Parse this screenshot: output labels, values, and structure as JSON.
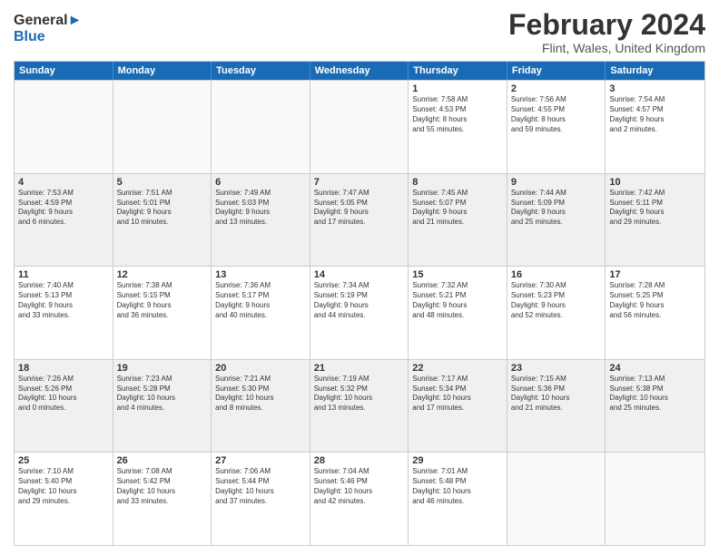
{
  "logo": {
    "line1": "General",
    "line2": "Blue"
  },
  "title": "February 2024",
  "subtitle": "Flint, Wales, United Kingdom",
  "days": [
    "Sunday",
    "Monday",
    "Tuesday",
    "Wednesday",
    "Thursday",
    "Friday",
    "Saturday"
  ],
  "rows": [
    [
      {
        "day": "",
        "empty": true
      },
      {
        "day": "",
        "empty": true
      },
      {
        "day": "",
        "empty": true
      },
      {
        "day": "",
        "empty": true
      },
      {
        "day": "1",
        "line1": "Sunrise: 7:58 AM",
        "line2": "Sunset: 4:53 PM",
        "line3": "Daylight: 8 hours",
        "line4": "and 55 minutes."
      },
      {
        "day": "2",
        "line1": "Sunrise: 7:56 AM",
        "line2": "Sunset: 4:55 PM",
        "line3": "Daylight: 8 hours",
        "line4": "and 59 minutes."
      },
      {
        "day": "3",
        "line1": "Sunrise: 7:54 AM",
        "line2": "Sunset: 4:57 PM",
        "line3": "Daylight: 9 hours",
        "line4": "and 2 minutes."
      }
    ],
    [
      {
        "day": "4",
        "line1": "Sunrise: 7:53 AM",
        "line2": "Sunset: 4:59 PM",
        "line3": "Daylight: 9 hours",
        "line4": "and 6 minutes."
      },
      {
        "day": "5",
        "line1": "Sunrise: 7:51 AM",
        "line2": "Sunset: 5:01 PM",
        "line3": "Daylight: 9 hours",
        "line4": "and 10 minutes."
      },
      {
        "day": "6",
        "line1": "Sunrise: 7:49 AM",
        "line2": "Sunset: 5:03 PM",
        "line3": "Daylight: 9 hours",
        "line4": "and 13 minutes."
      },
      {
        "day": "7",
        "line1": "Sunrise: 7:47 AM",
        "line2": "Sunset: 5:05 PM",
        "line3": "Daylight: 9 hours",
        "line4": "and 17 minutes."
      },
      {
        "day": "8",
        "line1": "Sunrise: 7:45 AM",
        "line2": "Sunset: 5:07 PM",
        "line3": "Daylight: 9 hours",
        "line4": "and 21 minutes."
      },
      {
        "day": "9",
        "line1": "Sunrise: 7:44 AM",
        "line2": "Sunset: 5:09 PM",
        "line3": "Daylight: 9 hours",
        "line4": "and 25 minutes."
      },
      {
        "day": "10",
        "line1": "Sunrise: 7:42 AM",
        "line2": "Sunset: 5:11 PM",
        "line3": "Daylight: 9 hours",
        "line4": "and 29 minutes."
      }
    ],
    [
      {
        "day": "11",
        "line1": "Sunrise: 7:40 AM",
        "line2": "Sunset: 5:13 PM",
        "line3": "Daylight: 9 hours",
        "line4": "and 33 minutes."
      },
      {
        "day": "12",
        "line1": "Sunrise: 7:38 AM",
        "line2": "Sunset: 5:15 PM",
        "line3": "Daylight: 9 hours",
        "line4": "and 36 minutes."
      },
      {
        "day": "13",
        "line1": "Sunrise: 7:36 AM",
        "line2": "Sunset: 5:17 PM",
        "line3": "Daylight: 9 hours",
        "line4": "and 40 minutes."
      },
      {
        "day": "14",
        "line1": "Sunrise: 7:34 AM",
        "line2": "Sunset: 5:19 PM",
        "line3": "Daylight: 9 hours",
        "line4": "and 44 minutes."
      },
      {
        "day": "15",
        "line1": "Sunrise: 7:32 AM",
        "line2": "Sunset: 5:21 PM",
        "line3": "Daylight: 9 hours",
        "line4": "and 48 minutes."
      },
      {
        "day": "16",
        "line1": "Sunrise: 7:30 AM",
        "line2": "Sunset: 5:23 PM",
        "line3": "Daylight: 9 hours",
        "line4": "and 52 minutes."
      },
      {
        "day": "17",
        "line1": "Sunrise: 7:28 AM",
        "line2": "Sunset: 5:25 PM",
        "line3": "Daylight: 9 hours",
        "line4": "and 56 minutes."
      }
    ],
    [
      {
        "day": "18",
        "line1": "Sunrise: 7:26 AM",
        "line2": "Sunset: 5:26 PM",
        "line3": "Daylight: 10 hours",
        "line4": "and 0 minutes."
      },
      {
        "day": "19",
        "line1": "Sunrise: 7:23 AM",
        "line2": "Sunset: 5:28 PM",
        "line3": "Daylight: 10 hours",
        "line4": "and 4 minutes."
      },
      {
        "day": "20",
        "line1": "Sunrise: 7:21 AM",
        "line2": "Sunset: 5:30 PM",
        "line3": "Daylight: 10 hours",
        "line4": "and 8 minutes."
      },
      {
        "day": "21",
        "line1": "Sunrise: 7:19 AM",
        "line2": "Sunset: 5:32 PM",
        "line3": "Daylight: 10 hours",
        "line4": "and 13 minutes."
      },
      {
        "day": "22",
        "line1": "Sunrise: 7:17 AM",
        "line2": "Sunset: 5:34 PM",
        "line3": "Daylight: 10 hours",
        "line4": "and 17 minutes."
      },
      {
        "day": "23",
        "line1": "Sunrise: 7:15 AM",
        "line2": "Sunset: 5:36 PM",
        "line3": "Daylight: 10 hours",
        "line4": "and 21 minutes."
      },
      {
        "day": "24",
        "line1": "Sunrise: 7:13 AM",
        "line2": "Sunset: 5:38 PM",
        "line3": "Daylight: 10 hours",
        "line4": "and 25 minutes."
      }
    ],
    [
      {
        "day": "25",
        "line1": "Sunrise: 7:10 AM",
        "line2": "Sunset: 5:40 PM",
        "line3": "Daylight: 10 hours",
        "line4": "and 29 minutes."
      },
      {
        "day": "26",
        "line1": "Sunrise: 7:08 AM",
        "line2": "Sunset: 5:42 PM",
        "line3": "Daylight: 10 hours",
        "line4": "and 33 minutes."
      },
      {
        "day": "27",
        "line1": "Sunrise: 7:06 AM",
        "line2": "Sunset: 5:44 PM",
        "line3": "Daylight: 10 hours",
        "line4": "and 37 minutes."
      },
      {
        "day": "28",
        "line1": "Sunrise: 7:04 AM",
        "line2": "Sunset: 5:46 PM",
        "line3": "Daylight: 10 hours",
        "line4": "and 42 minutes."
      },
      {
        "day": "29",
        "line1": "Sunrise: 7:01 AM",
        "line2": "Sunset: 5:48 PM",
        "line3": "Daylight: 10 hours",
        "line4": "and 46 minutes."
      },
      {
        "day": "",
        "empty": true
      },
      {
        "day": "",
        "empty": true
      }
    ]
  ]
}
